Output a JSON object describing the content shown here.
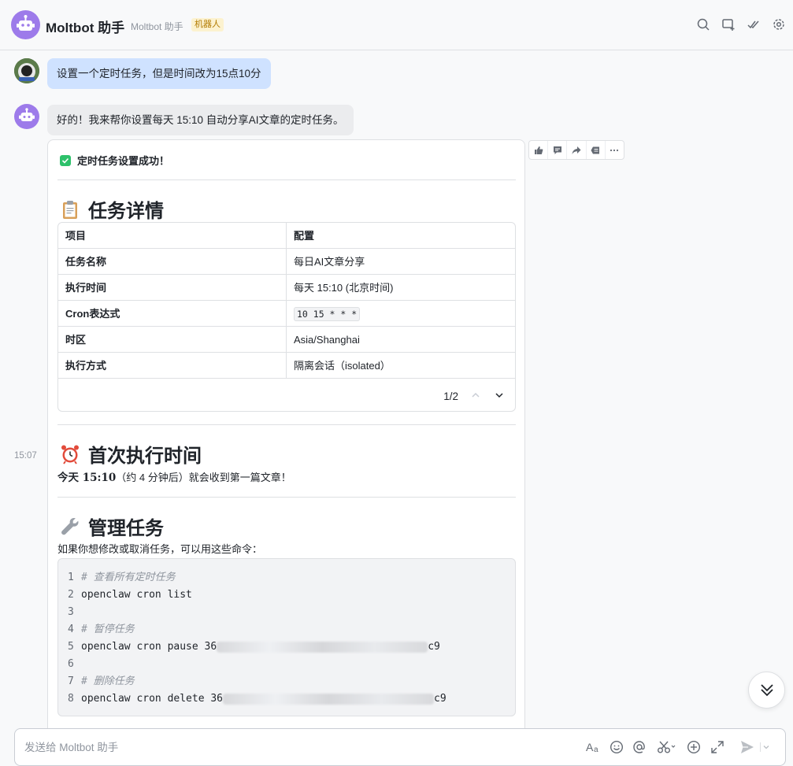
{
  "header": {
    "title": "Moltbot 助手",
    "subtitle": "Moltbot 助手",
    "badge": "机器人"
  },
  "messages": {
    "user_text": "设置一个定时任务，但是时间改为15点10分",
    "bot_text": "好的！我来帮你设置每天 15:10 自动分享AI文章的定时任务。",
    "timestamp": "15:07"
  },
  "card": {
    "success": "定时任务设置成功！",
    "details_title": "任务详情",
    "table": {
      "headers": [
        "项目",
        "配置"
      ],
      "rows": [
        [
          "任务名称",
          "每日AI文章分享"
        ],
        [
          "执行时间",
          "每天 15:10 (北京时间)"
        ],
        [
          "Cron表达式",
          "10 15 * * *"
        ],
        [
          "时区",
          "Asia/Shanghai"
        ],
        [
          "执行方式",
          "隔离会话（isolated）"
        ]
      ],
      "pager": "1/2"
    },
    "first_run_title": "首次执行时间",
    "first_run_bold": "今天 15:10",
    "first_run_rest": "（约 4 分钟后）就会收到第一篇文章！",
    "manage_title": "管理任务",
    "manage_desc": "如果你想修改或取消任务，可以用这些命令：",
    "code": [
      {
        "n": "1",
        "text": "# 查看所有定时任务",
        "comment": true
      },
      {
        "n": "2",
        "text": "openclaw cron list",
        "comment": false
      },
      {
        "n": "3",
        "text": "",
        "comment": false
      },
      {
        "n": "4",
        "text": "# 暂停任务",
        "comment": true
      },
      {
        "n": "5",
        "text": "openclaw cron pause 36",
        "suffix": "c9",
        "comment": false
      },
      {
        "n": "6",
        "text": "",
        "comment": false
      },
      {
        "n": "7",
        "text": "# 删除任务",
        "comment": true
      },
      {
        "n": "8",
        "text": "openclaw cron delete 36",
        "suffix": "c9",
        "comment": false
      }
    ]
  },
  "input": {
    "placeholder": "发送给 Moltbot 助手"
  },
  "colors": {
    "accent": "#9d7bea",
    "user_bubble": "#cfe2ff",
    "success_green": "#2ec16b"
  }
}
